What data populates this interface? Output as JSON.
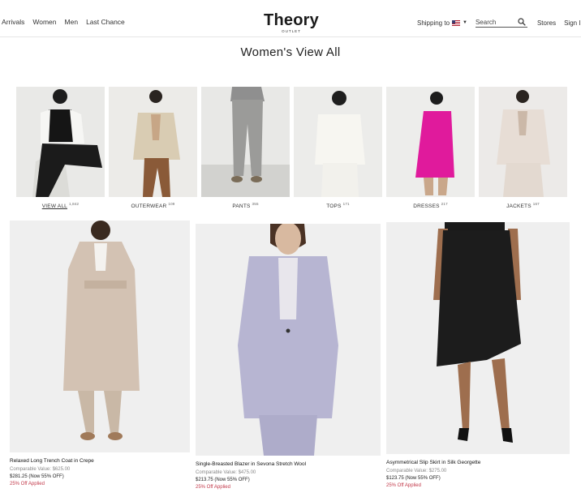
{
  "header": {
    "nav": [
      "w Arrivals",
      "Women",
      "Men",
      "Last Chance"
    ],
    "logo": "Theory",
    "logo_sub": "OUTLET",
    "shipping_label": "Shipping to",
    "search_placeholder": "Search",
    "stores": "Stores",
    "sign_in": "Sign In"
  },
  "page_title": "Women's View All",
  "categories": [
    {
      "label": "VIEW ALL",
      "count": "1,842"
    },
    {
      "label": "OUTERWEAR",
      "count": "109"
    },
    {
      "label": "PANTS",
      "count": "355"
    },
    {
      "label": "TOPS",
      "count": "171"
    },
    {
      "label": "DRESSES",
      "count": "217"
    },
    {
      "label": "JACKETS",
      "count": "167"
    }
  ],
  "products": [
    {
      "name": "Relaxed Long Trench Coat in Crepe",
      "compare": "Comparable Value: $625.00",
      "price": "$281.25 (Now 55% OFF)",
      "promo": "25% Off Applied"
    },
    {
      "name": "Single-Breasted Blazer in Sevona Stretch Wool",
      "compare": "Comparable Value: $475.00",
      "price": "$213.75 (Now 55% OFF)",
      "promo": "25% Off Applied"
    },
    {
      "name": "Asymmetrical Slip Skirt in Silk Georgette",
      "compare": "Comparable Value: $275.00",
      "price": "$123.75 (Now 55% OFF)",
      "promo": "25% Off Applied"
    }
  ]
}
